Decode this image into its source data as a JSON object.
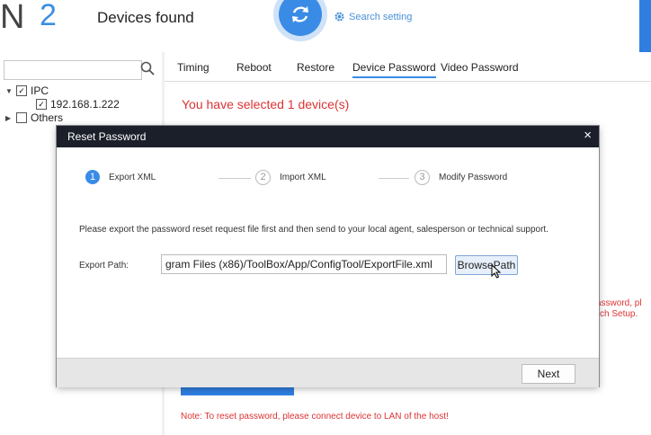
{
  "header": {
    "logo_letter": "N",
    "device_count": "2",
    "devices_found_label": "Devices found",
    "search_setting_label": "Search setting"
  },
  "tree": {
    "search_placeholder": "",
    "nodes": [
      {
        "label": "IPC",
        "expanded": true,
        "checked": true
      },
      {
        "label": "192.168.1.222",
        "checked": true
      },
      {
        "label": "Others",
        "expanded": false,
        "checked": false
      }
    ]
  },
  "tabs": [
    "Timing",
    "Reboot",
    "Restore",
    "Device Password",
    "Video Password"
  ],
  "active_tab": "Device Password",
  "content": {
    "selected_message": "You have selected 1 device(s)",
    "partial_text_1": "assword, pl",
    "partial_text_2": "ch Setup.",
    "note": "Note: To reset password, please connect device to LAN of the host!"
  },
  "dialog": {
    "title": "Reset Password",
    "close_glyph": "×",
    "steps": [
      {
        "number": "1",
        "label": "Export XML",
        "active": true
      },
      {
        "number": "2",
        "label": "Import XML",
        "active": false
      },
      {
        "number": "3",
        "label": "Modify Password",
        "active": false
      }
    ],
    "info_text": "Please export the password reset request file first and then send to your local agent, salesperson or technical support.",
    "export_path_label": "Export Path:",
    "export_path_value": "gram Files (x86)/ToolBox/App/ConfigTool/ExportFile.xml",
    "browse_label": "BrowsePath",
    "next_label": "Next"
  },
  "colors": {
    "accent": "#3a8be6",
    "error": "#dd3333",
    "dialog_title_bg": "#1b1f2a"
  }
}
